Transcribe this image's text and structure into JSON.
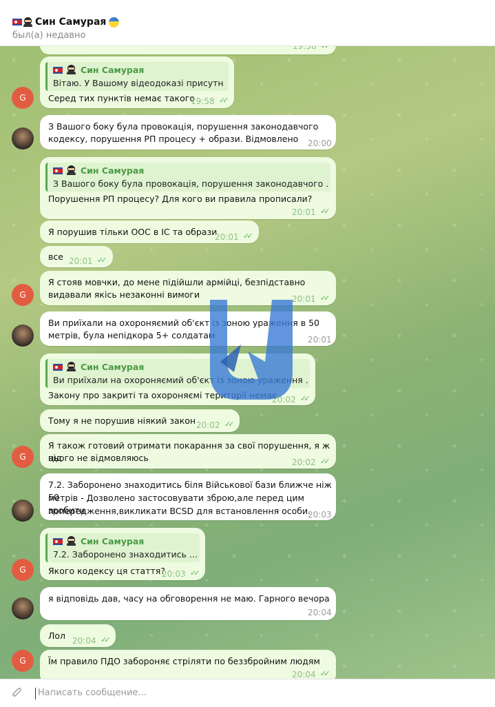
{
  "header": {
    "title": "Син Самурая",
    "status": "был(а) недавно"
  },
  "input": {
    "placeholder": "Написать сообщение..."
  },
  "messages": [
    {
      "time": "19:58"
    },
    {
      "quote_name": "Син Самурая",
      "quote_text": "Вітаю. У Вашому відеодоказі присутні...",
      "text": "Серед тих пунктів немає такого",
      "time": "19:58"
    },
    {
      "text_l1": "З Вашого боку була провокація, порушення законодавчого",
      "text_l2": "кодексу, порушення РП процесу + образи. Відмовлено",
      "time": "20:00"
    },
    {
      "quote_name": "Син Самурая",
      "quote_text": "З Вашого боку була провокація, порушення законодавчого ...",
      "text": "Порушення РП процесу? Для кого ви правила прописали?",
      "time": "20:01"
    },
    {
      "text": "Я порушив тільки ООС в ІС та образи",
      "time": "20:01"
    },
    {
      "text": "все",
      "time": "20:01"
    },
    {
      "text_l1": "Я стояв мовчки, до мене підійшли армійці, безпідставно",
      "text_l2": "видавали якісь незаконні вимоги",
      "time": "20:01"
    },
    {
      "text_l1": "Ви приїхали на охороняємий об'єкт із зоною ураження в 50",
      "text_l2": "метрів, була непідкора 5+ солдатам",
      "time": "20:01"
    },
    {
      "quote_name": "Син Самурая",
      "quote_text": "Ви приїхали на охороняємий об'єкт із зоною ураження ...",
      "text": "Закону про закриті та охороняємі територїї немає",
      "time": "20:02"
    },
    {
      "text": "Тому я не порушив ніякий закон",
      "time": "20:02"
    },
    {
      "text_l1": "Я також готовий отримати покарання за свої порушення, я ж від",
      "text_l2": "цього не відмовляюсь",
      "time": "20:02"
    },
    {
      "text_l1": "7.2. Заборонено знаходитись біля Військової бази ближче ніж 50",
      "text_l2": "метрів - Дозволено застосовувати зброю,але перед цим зробити",
      "text_l3": "попередження,викликати BCSD для встановлення особи.",
      "time": "20:03"
    },
    {
      "quote_name": "Син Самурая",
      "quote_text": "7.2. Заборонено знаходитись ...",
      "text": "Якого кодексу ця стаття?",
      "time": "20:03"
    },
    {
      "text": "я відповідь дав, часу на обговорення не маю. Гарного вечора",
      "time": "20:04"
    },
    {
      "text": "Лол",
      "time": "20:04"
    },
    {
      "text": "Їм правило ПДО забороняє стріляти по беззбройним людям",
      "time": "20:04"
    }
  ],
  "avatars": {
    "g_letter": "G"
  },
  "colors": {
    "accent": "#5aa64f",
    "avatar_g": "#e25c42",
    "outgoing": "#eefbe0"
  }
}
